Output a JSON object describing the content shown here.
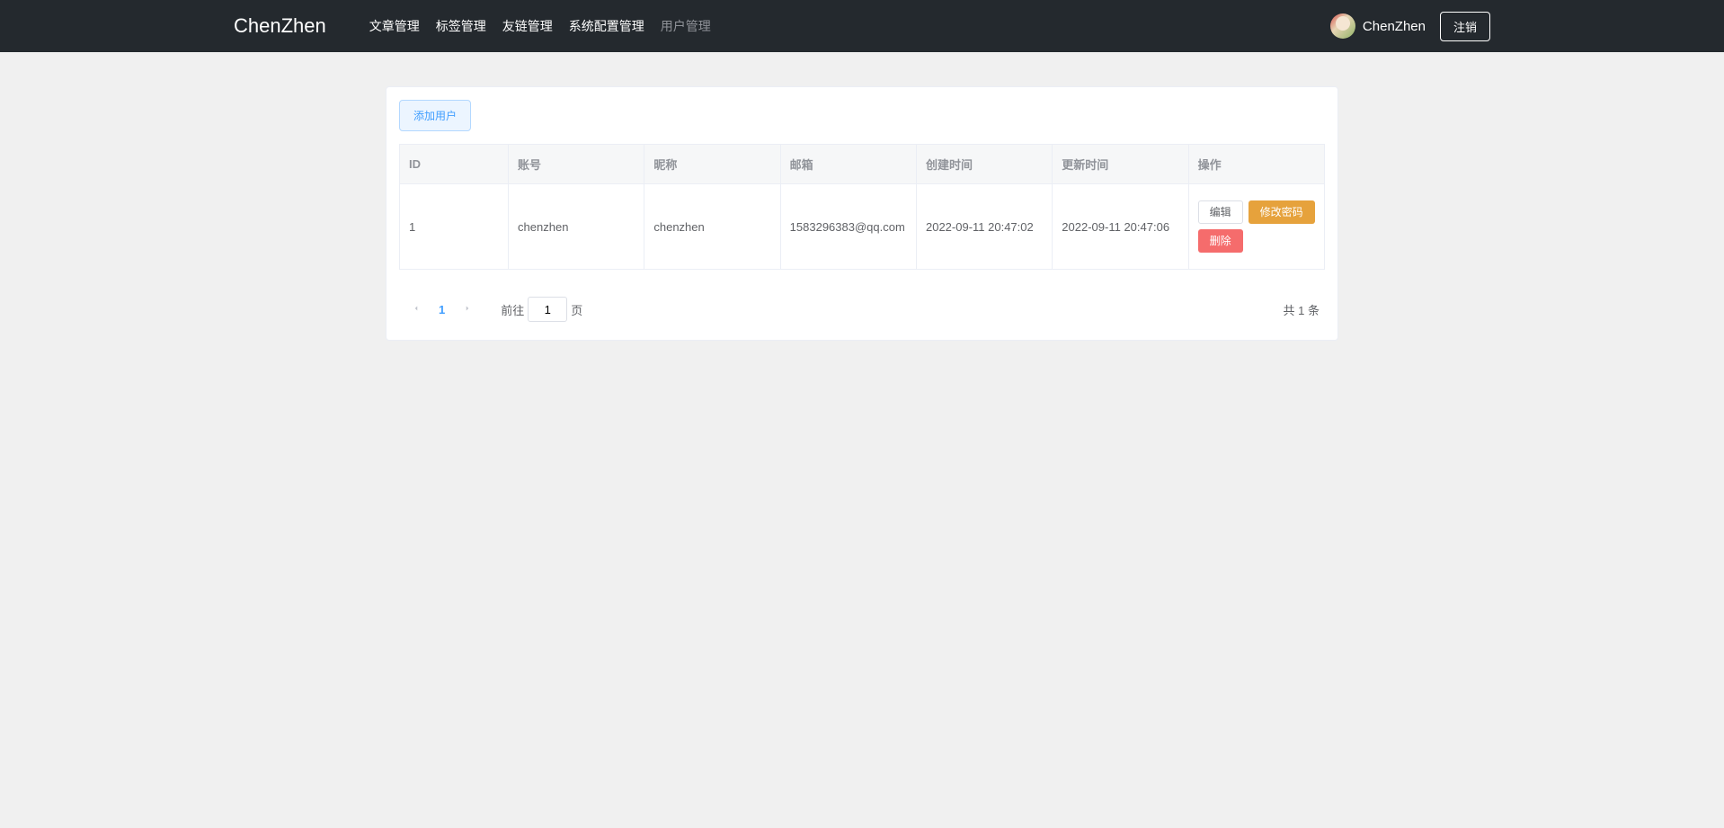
{
  "header": {
    "brand": "ChenZhen",
    "nav": [
      {
        "label": "文章管理",
        "active": false
      },
      {
        "label": "标签管理",
        "active": false
      },
      {
        "label": "友链管理",
        "active": false
      },
      {
        "label": "系统配置管理",
        "active": false
      },
      {
        "label": "用户管理",
        "active": true
      }
    ],
    "username": "ChenZhen",
    "logout_label": "注销"
  },
  "toolbar": {
    "add_user_label": "添加用户"
  },
  "table": {
    "headers": {
      "id": "ID",
      "account": "账号",
      "nickname": "昵称",
      "email": "邮箱",
      "created_at": "创建时间",
      "updated_at": "更新时间",
      "actions": "操作"
    },
    "rows": [
      {
        "id": "1",
        "account": "chenzhen",
        "nickname": "chenzhen",
        "email": "1583296383@qq.com",
        "created_at": "2022-09-11 20:47:02",
        "updated_at": "2022-09-11 20:47:06"
      }
    ],
    "action_labels": {
      "edit": "编辑",
      "change_password": "修改密码",
      "delete": "删除"
    }
  },
  "pagination": {
    "current_page": "1",
    "jump_prefix": "前往",
    "jump_input_value": "1",
    "jump_suffix": "页",
    "total_text": "共 1 条"
  }
}
